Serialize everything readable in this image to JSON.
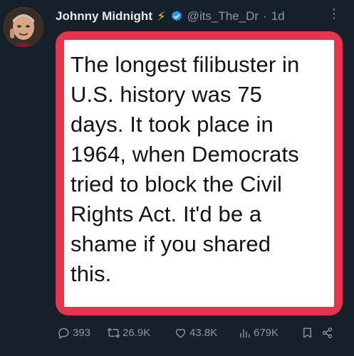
{
  "author": {
    "display_name": "Johnny Midnight",
    "badge_emoji": "⚡",
    "handle": "@its_The_Dr",
    "timestamp": "1d",
    "verified": true,
    "avatar_icon": "avatar-photo"
  },
  "post": {
    "image_text": "The longest filibuster in\nU.S. history was 75\ndays. It took place in\n1964, when Democrats\ntried to block the Civil\nRights Act. It'd be a\nshame if you shared\nthis.",
    "frame_color": "#e8334f"
  },
  "actions": {
    "replies": "393",
    "reposts": "26.9K",
    "likes": "43.8K",
    "views": "679K"
  },
  "colors": {
    "background": "#16202b",
    "muted_text": "#8b98a5",
    "verified_blue": "#1d9bf0"
  }
}
